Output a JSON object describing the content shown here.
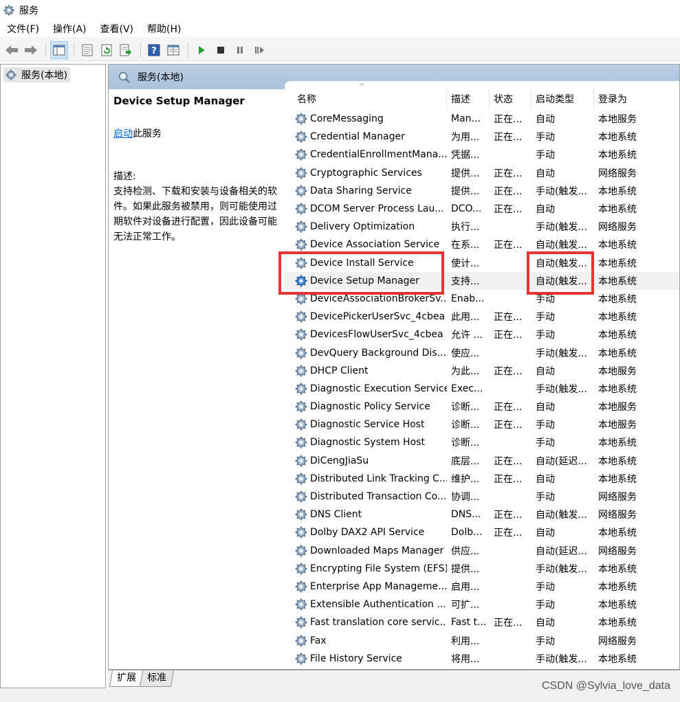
{
  "window": {
    "title": "服务",
    "icon": "gear-icon"
  },
  "menu": [
    "文件(F)",
    "操作(A)",
    "查看(V)",
    "帮助(H)"
  ],
  "toolbar": {
    "icons": [
      "back-arrow-icon",
      "forward-arrow-icon",
      "show-tree-icon",
      "properties-icon",
      "refresh-icon",
      "export-list-icon",
      "help-icon",
      "console-view-icon",
      "start-icon",
      "stop-icon",
      "pause-icon",
      "resume-icon"
    ]
  },
  "tree": {
    "root_label": "服务(本地)"
  },
  "content": {
    "header_label": "服务(本地)"
  },
  "detail": {
    "service_name": "Device Setup Manager",
    "start_link": "启动",
    "start_suffix": "此服务",
    "desc_label": "描述:",
    "desc_text": "支持检测、下载和安装与设备相关的软件。如果此服务被禁用，则可能使用过期软件对设备进行配置，因此设备可能无法正常工作。"
  },
  "columns": {
    "name": "名称",
    "desc": "描述",
    "status": "状态",
    "startup": "启动类型",
    "logon": "登录为"
  },
  "rows": [
    {
      "name": "CoreMessaging",
      "desc": "Man...",
      "status": "正在...",
      "startup": "自动",
      "logon": "本地服务"
    },
    {
      "name": "Credential Manager",
      "desc": "为用...",
      "status": "正在...",
      "startup": "手动",
      "logon": "本地系统"
    },
    {
      "name": "CredentialEnrollmentMana...",
      "desc": "凭据...",
      "status": "",
      "startup": "手动",
      "logon": "本地系统"
    },
    {
      "name": "Cryptographic Services",
      "desc": "提供...",
      "status": "正在...",
      "startup": "自动",
      "logon": "网络服务"
    },
    {
      "name": "Data Sharing Service",
      "desc": "提供...",
      "status": "正在...",
      "startup": "手动(触发...",
      "logon": "本地系统"
    },
    {
      "name": "DCOM Server Process Lau...",
      "desc": "DCO...",
      "status": "正在...",
      "startup": "自动",
      "logon": "本地系统"
    },
    {
      "name": "Delivery Optimization",
      "desc": "执行...",
      "status": "",
      "startup": "手动(触发...",
      "logon": "网络服务"
    },
    {
      "name": "Device Association Service",
      "desc": "在系...",
      "status": "正在...",
      "startup": "自动(触发...",
      "logon": "本地系统"
    },
    {
      "name": "Device Install Service",
      "desc": "使计...",
      "status": "",
      "startup": "自动(触发...",
      "logon": "本地系统"
    },
    {
      "name": "Device Setup Manager",
      "desc": "支持...",
      "status": "",
      "startup": "自动(触发...",
      "logon": "本地系统"
    },
    {
      "name": "DeviceAssociationBrokerSv...",
      "desc": "Enab...",
      "status": "",
      "startup": "手动",
      "logon": "本地系统"
    },
    {
      "name": "DevicePickerUserSvc_4cbea",
      "desc": "此用...",
      "status": "正在...",
      "startup": "手动",
      "logon": "本地系统"
    },
    {
      "name": "DevicesFlowUserSvc_4cbea",
      "desc": "允许 ...",
      "status": "正在...",
      "startup": "手动",
      "logon": "本地系统"
    },
    {
      "name": "DevQuery Background Dis...",
      "desc": "使应...",
      "status": "",
      "startup": "手动(触发...",
      "logon": "本地系统"
    },
    {
      "name": "DHCP Client",
      "desc": "为此...",
      "status": "正在...",
      "startup": "自动",
      "logon": "本地服务"
    },
    {
      "name": "Diagnostic Execution Service",
      "desc": "Exec...",
      "status": "",
      "startup": "手动(触发...",
      "logon": "本地系统"
    },
    {
      "name": "Diagnostic Policy Service",
      "desc": "诊断...",
      "status": "正在...",
      "startup": "自动",
      "logon": "本地服务"
    },
    {
      "name": "Diagnostic Service Host",
      "desc": "诊断...",
      "status": "正在...",
      "startup": "手动",
      "logon": "本地服务"
    },
    {
      "name": "Diagnostic System Host",
      "desc": "诊断...",
      "status": "",
      "startup": "手动",
      "logon": "本地系统"
    },
    {
      "name": "DiCengJiaSu",
      "desc": "底层...",
      "status": "正在...",
      "startup": "自动(延迟...",
      "logon": "本地系统"
    },
    {
      "name": "Distributed Link Tracking C...",
      "desc": "维护...",
      "status": "正在...",
      "startup": "自动",
      "logon": "本地系统"
    },
    {
      "name": "Distributed Transaction Co...",
      "desc": "协调...",
      "status": "",
      "startup": "手动",
      "logon": "网络服务"
    },
    {
      "name": "DNS Client",
      "desc": "DNS...",
      "status": "正在...",
      "startup": "自动(触发...",
      "logon": "网络服务"
    },
    {
      "name": "Dolby DAX2 API Service",
      "desc": "Dolb...",
      "status": "正在...",
      "startup": "自动",
      "logon": "本地系统"
    },
    {
      "name": "Downloaded Maps Manager",
      "desc": "供应...",
      "status": "",
      "startup": "自动(延迟...",
      "logon": "网络服务"
    },
    {
      "name": "Encrypting File System (EFS)",
      "desc": "提供...",
      "status": "",
      "startup": "手动(触发...",
      "logon": "本地系统"
    },
    {
      "name": "Enterprise App Manageme...",
      "desc": "启用...",
      "status": "",
      "startup": "手动",
      "logon": "本地系统"
    },
    {
      "name": "Extensible Authentication ...",
      "desc": "可扩...",
      "status": "",
      "startup": "手动",
      "logon": "本地系统"
    },
    {
      "name": "Fast translation core servic...",
      "desc": "Fast t...",
      "status": "正在...",
      "startup": "自动",
      "logon": "本地系统"
    },
    {
      "name": "Fax",
      "desc": "利用...",
      "status": "",
      "startup": "手动",
      "logon": "网络服务"
    },
    {
      "name": "File History Service",
      "desc": "将用...",
      "status": "",
      "startup": "手动(触发...",
      "logon": "本地系统"
    }
  ],
  "selected_row": "Device Setup Manager",
  "tabs": [
    "扩展",
    "标准"
  ],
  "watermark": "CSDN @Sylvia_love_data",
  "colors": {
    "highlight_box": "#e63333",
    "header_bar": "#b4c9df",
    "link": "#0066cc"
  }
}
